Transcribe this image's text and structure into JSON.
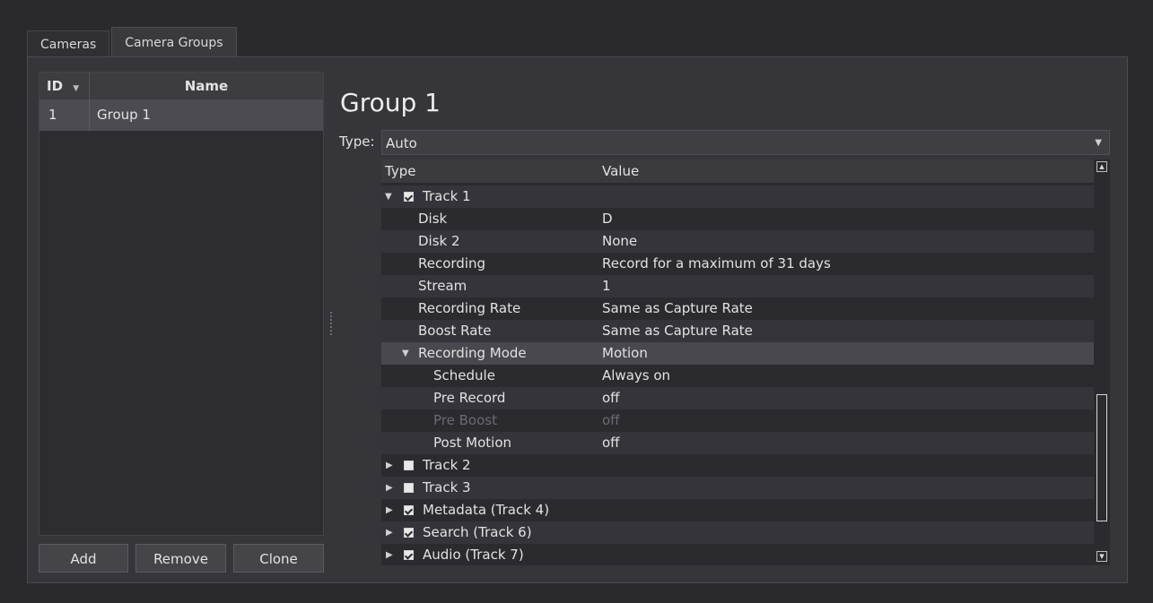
{
  "tabs": [
    "Cameras",
    "Camera Groups"
  ],
  "groups": {
    "columns": {
      "id": "ID",
      "name": "Name"
    },
    "sort_icon": "sort-down-icon",
    "rows": [
      {
        "id": "1",
        "name": "Group 1"
      }
    ]
  },
  "buttons": {
    "add": "Add",
    "remove": "Remove",
    "clone": "Clone"
  },
  "detail": {
    "title": "Group 1",
    "type_label": "Type:",
    "type_value": "Auto",
    "tree_columns": {
      "type": "Type",
      "value": "Value"
    },
    "rows": [
      {
        "label": "Track 1",
        "value": "",
        "expanded": true,
        "checkbox": true
      },
      {
        "label": "Disk",
        "value": "D"
      },
      {
        "label": "Disk 2",
        "value": "None"
      },
      {
        "label": "Recording",
        "value": "Record for a maximum of 31 days"
      },
      {
        "label": "Stream",
        "value": "1"
      },
      {
        "label": "Recording Rate",
        "value": "Same as Capture Rate"
      },
      {
        "label": "Boost Rate",
        "value": "Same as Capture Rate"
      },
      {
        "label": "Recording Mode",
        "value": "Motion",
        "expanded": true
      },
      {
        "label": "Schedule",
        "value": "Always on"
      },
      {
        "label": "Pre Record",
        "value": "off"
      },
      {
        "label": "Pre Boost",
        "value": "off",
        "disabled": true
      },
      {
        "label": "Post Motion",
        "value": "off"
      },
      {
        "label": "Track 2",
        "value": "",
        "expanded": false,
        "checkbox": false
      },
      {
        "label": "Track 3",
        "value": "",
        "expanded": false,
        "checkbox": false
      },
      {
        "label": "Metadata (Track 4)",
        "value": "",
        "expanded": false,
        "checkbox": true
      },
      {
        "label": "Search (Track 6)",
        "value": "",
        "expanded": false,
        "checkbox": true
      },
      {
        "label": "Audio (Track 7)",
        "value": "",
        "expanded": false,
        "checkbox": true
      }
    ]
  }
}
